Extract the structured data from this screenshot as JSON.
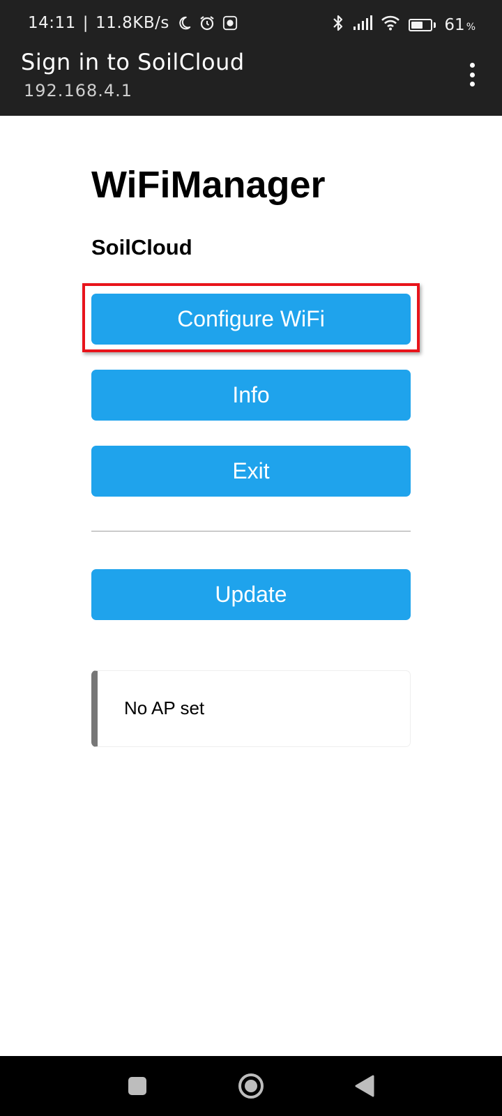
{
  "status_bar": {
    "time": "14:11",
    "separator": "|",
    "net_speed": "11.8KB/s",
    "battery_percent": "61",
    "battery_sign": "%",
    "battery_level": 0.61,
    "icons_left": [
      "moon-icon",
      "alarm-icon",
      "app-notification-icon"
    ],
    "icons_right": [
      "bluetooth-icon",
      "cellular-signal-icon",
      "wifi-icon",
      "battery-icon"
    ]
  },
  "portal_bar": {
    "title": "Sign in to SoilCloud",
    "url": "192.168.4.1",
    "menu_icon": "overflow-menu-icon"
  },
  "main": {
    "heading": "WiFiManager",
    "device_name": "SoilCloud",
    "buttons": {
      "configure": "Configure WiFi",
      "info": "Info",
      "exit": "Exit",
      "update": "Update"
    },
    "status_message": "No AP set"
  },
  "colors": {
    "header_bg": "#212121",
    "button_bg": "#1fa3ec",
    "highlight": "#e8141b",
    "msg_border": "#777777"
  },
  "nav_bar": {
    "items": [
      "recents-icon",
      "home-icon",
      "back-icon"
    ]
  }
}
